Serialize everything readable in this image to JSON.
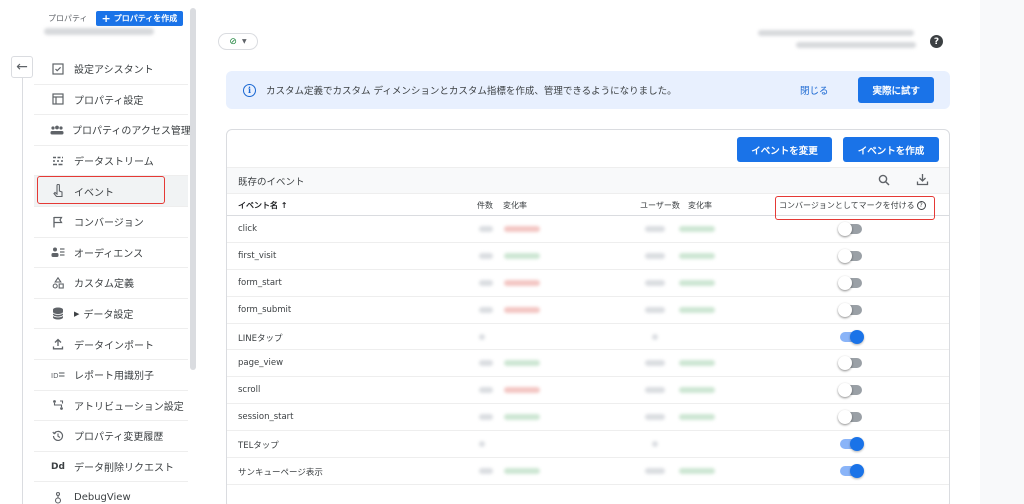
{
  "sidebar": {
    "property_label": "プロパティ",
    "create_property": "プロパティを作成",
    "items": [
      {
        "label": "設定アシスタント",
        "icon": "checklist-icon"
      },
      {
        "label": "プロパティ設定",
        "icon": "property-settings-icon"
      },
      {
        "label": "プロパティのアクセス管理",
        "icon": "people-icon"
      },
      {
        "label": "データストリーム",
        "icon": "streams-icon"
      },
      {
        "label": "イベント",
        "icon": "touch-icon",
        "active": true
      },
      {
        "label": "コンバージョン",
        "icon": "flag-icon"
      },
      {
        "label": "オーディエンス",
        "icon": "audience-icon"
      },
      {
        "label": "カスタム定義",
        "icon": "shapes-icon"
      },
      {
        "label": "データ設定",
        "icon": "database-icon",
        "expandable": true
      },
      {
        "label": "データインポート",
        "icon": "upload-icon"
      },
      {
        "label": "レポート用識別子",
        "icon": "identifier-icon"
      },
      {
        "label": "アトリビューション設定",
        "icon": "attribution-icon"
      },
      {
        "label": "プロパティ変更履歴",
        "icon": "history-icon"
      },
      {
        "label": "データ削除リクエスト",
        "icon": "dd-icon"
      },
      {
        "label": "DebugView",
        "icon": "debug-icon"
      }
    ],
    "dd_glyph": "Dd"
  },
  "banner": {
    "message": "カスタム定義でカスタム ディメンションとカスタム指標を作成、管理できるようになりました。",
    "close": "閉じる",
    "try": "実際に試す"
  },
  "card": {
    "modify_button": "イベントを変更",
    "create_button": "イベントを作成",
    "table_title": "既存のイベント",
    "columns": {
      "name": "イベント名 ↑",
      "count": "件数",
      "rate1": "変化率",
      "users": "ユーザー数",
      "rate2": "変化率",
      "conversion": "コンバージョンとしてマークを付ける"
    },
    "rows": [
      {
        "name": "click",
        "conversion": false,
        "trend": "down"
      },
      {
        "name": "first_visit",
        "conversion": false,
        "trend": "up"
      },
      {
        "name": "form_start",
        "conversion": false,
        "trend": "down"
      },
      {
        "name": "form_submit",
        "conversion": false,
        "trend": "down"
      },
      {
        "name": "LINEタップ",
        "conversion": true,
        "trend": "none"
      },
      {
        "name": "page_view",
        "conversion": false,
        "trend": "up"
      },
      {
        "name": "scroll",
        "conversion": false,
        "trend": "down"
      },
      {
        "name": "session_start",
        "conversion": false,
        "trend": "up"
      },
      {
        "name": "TELタップ",
        "conversion": true,
        "trend": "none"
      },
      {
        "name": "サンキューページ表示",
        "conversion": true,
        "trend": "up"
      }
    ]
  },
  "colors": {
    "primary": "#1a73e8",
    "highlight": "#e53935",
    "banner_bg": "#e8f0fe"
  }
}
